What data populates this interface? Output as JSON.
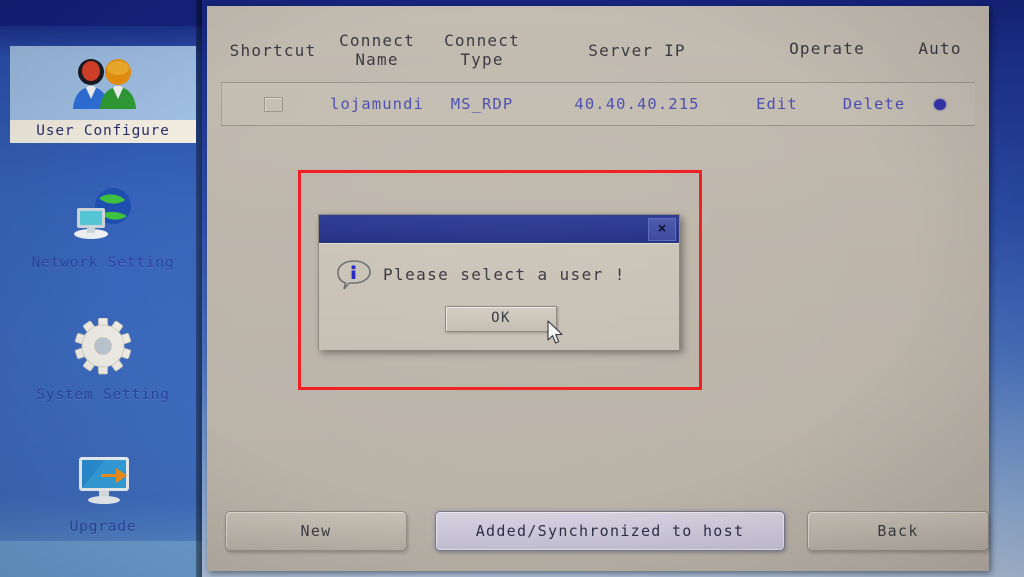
{
  "sidebar": {
    "items": [
      {
        "label": "User Configure",
        "icon": "users-icon",
        "selected": true
      },
      {
        "label": "Network Setting",
        "icon": "network-icon",
        "selected": false
      },
      {
        "label": "System Setting",
        "icon": "gear-icon",
        "selected": false
      },
      {
        "label": "Upgrade",
        "icon": "upgrade-icon",
        "selected": false
      }
    ]
  },
  "table": {
    "columns": [
      {
        "label": "Shortcut"
      },
      {
        "label": "Connect\nName"
      },
      {
        "label": "Connect\nType"
      },
      {
        "label": "Server IP"
      },
      {
        "label": "Operate"
      },
      {
        "label": "Auto"
      }
    ],
    "column_labels": {
      "shortcut": "Shortcut",
      "connect_name_line1": "Connect",
      "connect_name_line2": "Name",
      "connect_type_line1": "Connect",
      "connect_type_line2": "Type",
      "server_ip": "Server IP",
      "operate": "Operate",
      "auto": "Auto"
    },
    "rows": [
      {
        "shortcut_checked": false,
        "connect_name": "lojamundi",
        "connect_type": "MS_RDP",
        "server_ip": "40.40.40.215",
        "edit_label": "Edit",
        "delete_label": "Delete",
        "auto_selected": true
      }
    ]
  },
  "dialog": {
    "title": "",
    "close_label": "×",
    "message": "Please select a user !",
    "ok_label": "OK",
    "icon": "info-bubble-icon"
  },
  "annotation": {
    "type": "red-highlight-rectangle",
    "color": "#f01d20"
  },
  "footer": {
    "buttons": [
      {
        "label": "New",
        "focused": false
      },
      {
        "label": "Added/Synchronized to host",
        "focused": true
      },
      {
        "label": "Back",
        "focused": false
      }
    ]
  },
  "colors": {
    "panel_background": "#bdb5aa",
    "sidebar_blue": "#3b68bb",
    "desktop_blue": "#2c4da8",
    "link_text": "#4a4ba8",
    "dialog_titlebar": "#27358c",
    "annotation_red": "#f01d20",
    "selected_nav_label_bg": "#f1ecdf"
  }
}
